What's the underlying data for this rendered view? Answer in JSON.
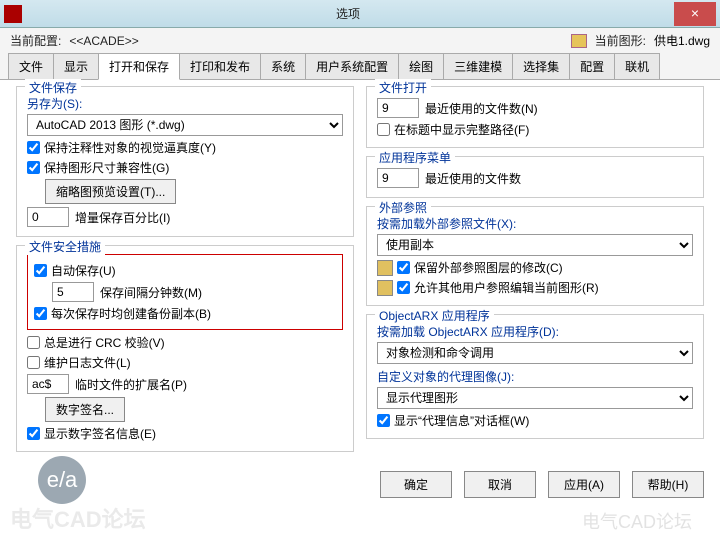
{
  "window": {
    "title": "选项",
    "close": "×"
  },
  "header": {
    "profile_lbl": "当前配置:",
    "profile_val": "<<ACADE>>",
    "drawing_lbl": "当前图形:",
    "drawing_val": "供电1.dwg"
  },
  "tabs": [
    "文件",
    "显示",
    "打开和保存",
    "打印和发布",
    "系统",
    "用户系统配置",
    "绘图",
    "三维建模",
    "选择集",
    "配置",
    "联机"
  ],
  "active_tab": 2,
  "left": {
    "file_save": {
      "title": "文件保存",
      "save_as_lbl": "另存为(S):",
      "save_as_val": "AutoCAD 2013 图形 (*.dwg)",
      "annot_fidelity": "保持注释性对象的视觉逼真度(Y)",
      "size_compat": "保持图形尺寸兼容性(G)",
      "thumb_btn": "缩略图预览设置(T)...",
      "inc_val": "0",
      "inc_lbl": "增量保存百分比(I)"
    },
    "file_safety": {
      "title": "文件安全措施",
      "autosave": "自动保存(U)",
      "autosave_val": "5",
      "autosave_lbl": "保存间隔分钟数(M)",
      "backup": "每次保存时均创建备份副本(B)",
      "crc": "总是进行 CRC 校验(V)",
      "logfile": "维护日志文件(L)",
      "ext_val": "ac$",
      "ext_lbl": "临时文件的扩展名(P)",
      "sig_btn": "数字签名...",
      "show_sig": "显示数字签名信息(E)"
    }
  },
  "right": {
    "file_open": {
      "title": "文件打开",
      "recent_val": "9",
      "recent_lbl": "最近使用的文件数(N)",
      "full_path": "在标题中显示完整路径(F)"
    },
    "app_menu": {
      "title": "应用程序菜单",
      "recent_val": "9",
      "recent_lbl": "最近使用的文件数"
    },
    "xref": {
      "title": "外部参照",
      "load_lbl": "按需加载外部参照文件(X):",
      "load_val": "使用副本",
      "retain": "保留外部参照图层的修改(C)",
      "allow": "允许其他用户参照编辑当前图形(R)"
    },
    "arx": {
      "title": "ObjectARX 应用程序",
      "load_lbl": "按需加载 ObjectARX 应用程序(D):",
      "load_val": "对象检测和命令调用",
      "proxy_lbl": "自定义对象的代理图像(J):",
      "proxy_val": "显示代理图形",
      "show_proxy": "显示“代理信息”对话框(W)"
    }
  },
  "buttons": {
    "ok": "确定",
    "cancel": "取消",
    "apply": "应用(A)",
    "help": "帮助(H)"
  },
  "watermarks": {
    "left": "电气CAD论坛",
    "right": "电气CAD论坛",
    "logo": "e/a"
  }
}
